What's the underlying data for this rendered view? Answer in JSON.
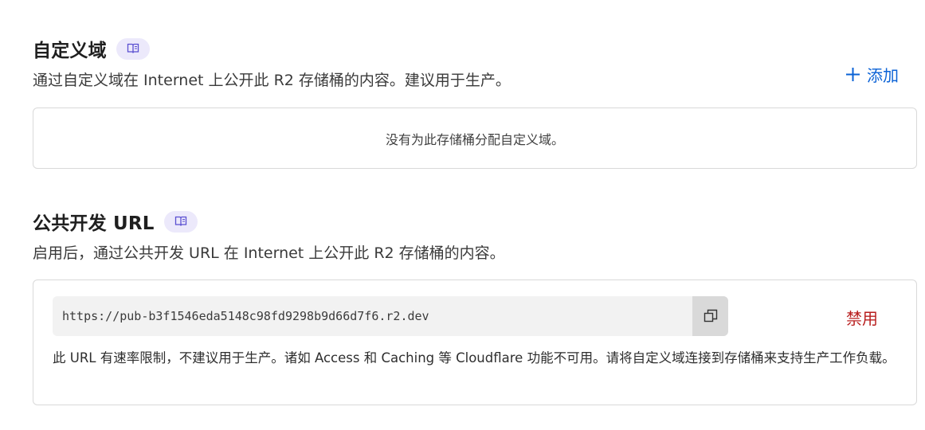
{
  "custom_domains": {
    "title": "自定义域",
    "description": "通过自定义域在 Internet 上公开此 R2 存储桶的内容。建议用于生产。",
    "add_label": "添加",
    "empty_message": "没有为此存储桶分配自定义域。",
    "doc_icon": "book-icon"
  },
  "public_dev_url": {
    "title": "公共开发 URL",
    "description": "启用后，通过公共开发 URL 在 Internet 上公开此 R2 存储桶的内容。",
    "url": "https://pub-b3f1546eda5148c98fd9298b9d66d7f6.r2.dev",
    "disable_label": "禁用",
    "warning": "此 URL 有速率限制，不建议用于生产。诸如 Access 和 Caching 等 Cloudflare 功能不可用。请将自定义域连接到存储桶来支持生产工作负载。",
    "doc_icon": "book-icon",
    "copy_icon": "copy-icon"
  },
  "colors": {
    "accent_blue": "#0a62d6",
    "danger_red": "#b81e1e",
    "badge_bg": "#ece9fb"
  }
}
